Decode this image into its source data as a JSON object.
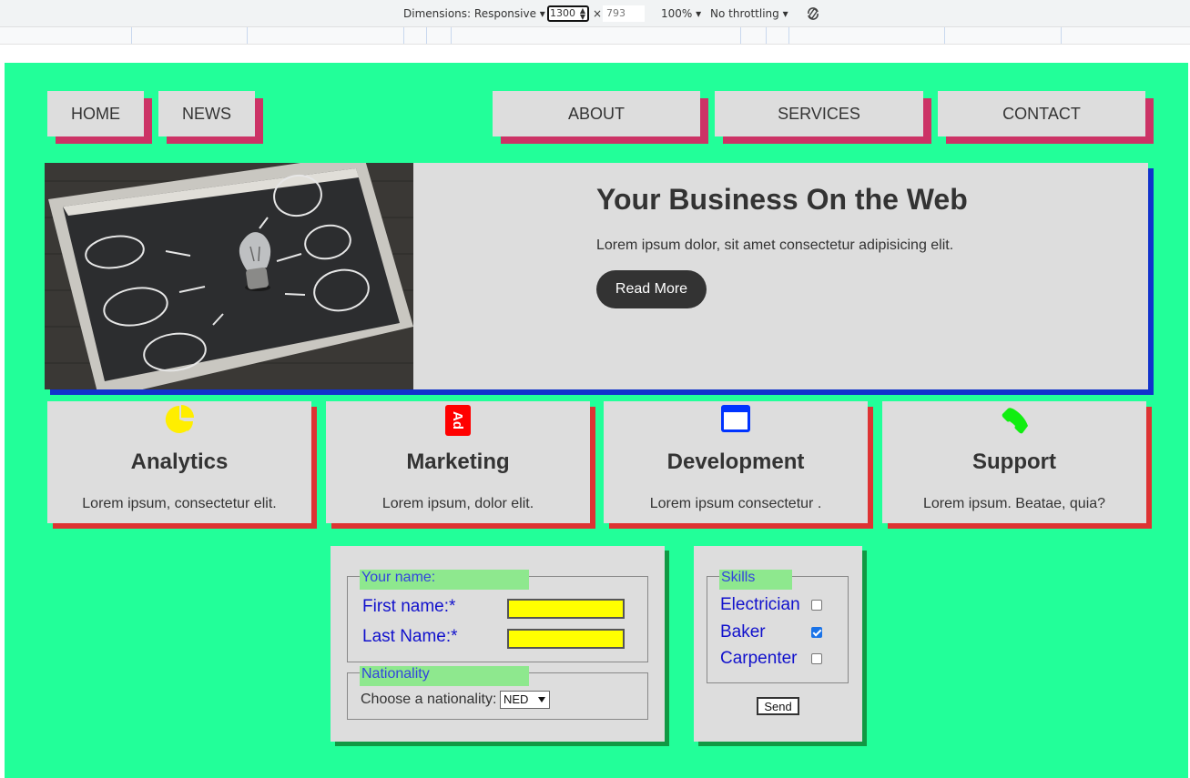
{
  "devtools": {
    "dimensions_label": "Dimensions: Responsive",
    "width_value": "1300",
    "times": "×",
    "height_value": "793",
    "zoom": "100%",
    "throttling": "No throttling"
  },
  "nav": {
    "home": "HOME",
    "news": "NEWS",
    "about": "ABOUT",
    "services": "SERVICES",
    "contact": "CONTACT"
  },
  "hero": {
    "title": "Your Business On the Web",
    "text": "Lorem ipsum dolor, sit amet consectetur adipisicing elit.",
    "button": "Read More"
  },
  "cards": [
    {
      "icon": "pie-chart-icon",
      "title": "Analytics",
      "text": "Lorem ipsum, consectetur elit."
    },
    {
      "icon": "ad-icon",
      "title": "Marketing",
      "text": "Lorem ipsum, dolor elit."
    },
    {
      "icon": "browser-window-icon",
      "title": "Development",
      "text": "Lorem ipsum consectetur ."
    },
    {
      "icon": "phone-icon",
      "title": "Support",
      "text": "Lorem ipsum. Beatae, quia?"
    }
  ],
  "form_name": {
    "legend": "Your name:",
    "first_label": "First name:*",
    "first_value": "",
    "last_label": "Last Name:*",
    "last_value": ""
  },
  "form_nationality": {
    "legend": "Nationality",
    "label": "Choose a nationality:",
    "selected": "NED"
  },
  "skills": {
    "legend": "Skills",
    "items": [
      {
        "label": "Electrician",
        "checked": false
      },
      {
        "label": "Baker",
        "checked": true
      },
      {
        "label": "Carpenter",
        "checked": false
      }
    ],
    "send": "Send"
  },
  "colors": {
    "page_bg": "#22ff99",
    "nav_shadow": "#cc3366",
    "hero_shadow": "#1133cc",
    "card_shadow": "#dd3333",
    "form_shadow": "#119944",
    "input_bg": "#ffff00",
    "legend_bg": "#8ee88e"
  }
}
